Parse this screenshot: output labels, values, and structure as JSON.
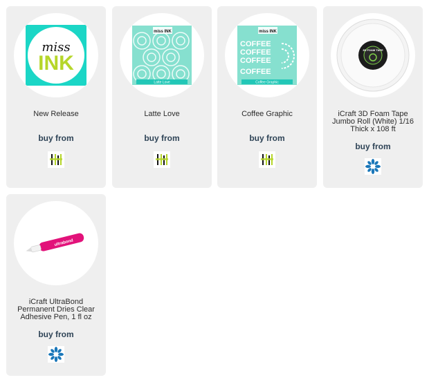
{
  "products": [
    {
      "title": "New Release",
      "buy_label": "buy from",
      "shop_icon": "miss-ink-shop-logo"
    },
    {
      "title": "Latte Love",
      "buy_label": "buy from",
      "shop_icon": "miss-ink-shop-logo"
    },
    {
      "title": "Coffee Graphic",
      "buy_label": "buy from",
      "shop_icon": "miss-ink-shop-logo"
    },
    {
      "title": "iCraft 3D Foam Tape Jumbo Roll (White) 1/16 Thick x 108 ft",
      "buy_label": "buy from",
      "shop_icon": "blue-flower-shop-logo"
    },
    {
      "title": "iCraft UltraBond Permanent Dries Clear Adhesive Pen, 1 fl oz",
      "buy_label": "buy from",
      "shop_icon": "blue-flower-shop-logo"
    }
  ],
  "images": {
    "new_release": {
      "logo_word_1": "miss",
      "logo_word_2": "INK"
    },
    "latte_love": {
      "brand": "miss INK",
      "label": "Latte Love"
    },
    "coffee_graphic": {
      "brand": "miss INK",
      "word": "COFFEE",
      "label": "Coffee Graphic"
    },
    "foam_tape": {
      "label": "3D FOAM TAPE"
    },
    "pen": {
      "label": "ultrabond"
    }
  },
  "colors": {
    "card_bg": "#efefef",
    "buy_text": "#2f4457",
    "teal": "#1bd6c6",
    "mint": "#86e0cf",
    "brand_green": "#b6d62a",
    "flower_blue": "#1a77b9",
    "pink": "#e2127a"
  }
}
